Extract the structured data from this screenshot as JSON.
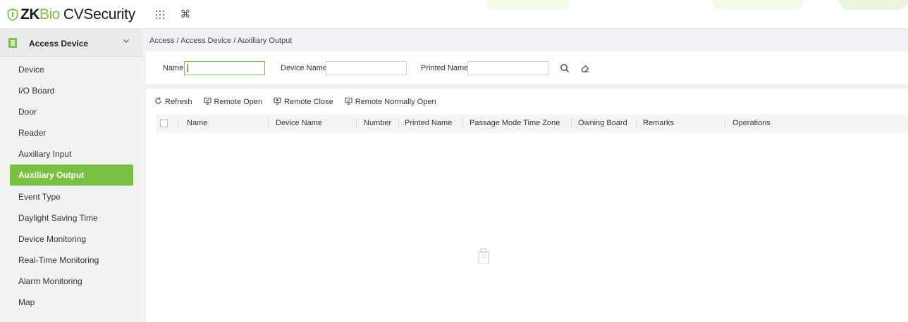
{
  "app": {
    "logo_zk": "ZK",
    "logo_bio": "Bio",
    "logo_product": "CVSecurity",
    "top_icons": [
      "apps-grid-icon",
      "command-icon"
    ],
    "accent_color": "#7ac143"
  },
  "sidebar": {
    "module_label": "Access Device",
    "items": [
      {
        "label": "Device",
        "active": false
      },
      {
        "label": "I/O Board",
        "active": false
      },
      {
        "label": "Door",
        "active": false
      },
      {
        "label": "Reader",
        "active": false
      },
      {
        "label": "Auxiliary Input",
        "active": false
      },
      {
        "label": "Auxiliary Output",
        "active": true
      },
      {
        "label": "Event Type",
        "active": false
      },
      {
        "label": "Daylight Saving Time",
        "active": false
      },
      {
        "label": "Device Monitoring",
        "active": false
      },
      {
        "label": "Real-Time Monitoring",
        "active": false
      },
      {
        "label": "Alarm Monitoring",
        "active": false
      },
      {
        "label": "Map",
        "active": false
      }
    ],
    "collapse_glyph": "«"
  },
  "breadcrumb": "Access / Access Device / Auxiliary Output",
  "filters": {
    "name_label": "Name",
    "name_value": "",
    "device_name_label": "Device Name",
    "device_name_value": "",
    "printed_name_label": "Printed Name",
    "printed_name_value": ""
  },
  "toolbar": {
    "refresh": "Refresh",
    "remote_open": "Remote Open",
    "remote_close": "Remote Close",
    "remote_normally_open": "Remote Normally Open"
  },
  "table": {
    "columns": [
      "Name",
      "Device Name",
      "Number",
      "Printed Name",
      "Passage Mode Time Zone",
      "Owning Board",
      "Remarks",
      "Operations"
    ],
    "rows": []
  }
}
